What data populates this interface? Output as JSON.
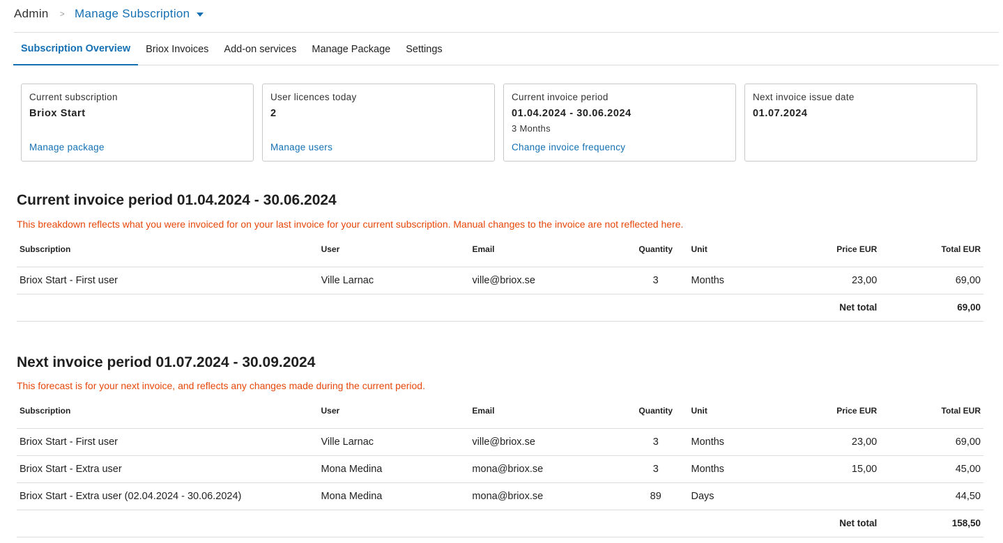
{
  "breadcrumb": {
    "root": "Admin",
    "separator": ">",
    "current": "Manage Subscription",
    "current_icon": "caret-down-icon"
  },
  "tabs": [
    {
      "label": "Subscription Overview",
      "active": true
    },
    {
      "label": "Briox Invoices",
      "active": false
    },
    {
      "label": "Add-on services",
      "active": false
    },
    {
      "label": "Manage Package",
      "active": false
    },
    {
      "label": "Settings",
      "active": false
    }
  ],
  "cards": [
    {
      "label": "Current subscription",
      "value": "Briox Start",
      "sub": "",
      "link": "Manage package"
    },
    {
      "label": "User licences today",
      "value": "2",
      "sub": "",
      "link": "Manage users"
    },
    {
      "label": "Current invoice period",
      "value": "01.04.2024 - 30.06.2024",
      "sub": "3 Months",
      "link": "Change invoice frequency"
    },
    {
      "label": "Next invoice issue date",
      "value": "01.07.2024",
      "sub": "",
      "link": ""
    }
  ],
  "columns": [
    "Subscription",
    "User",
    "Email",
    "Quantity",
    "Unit",
    "Price EUR",
    "Total EUR"
  ],
  "current_period": {
    "title": "Current invoice period 01.04.2024 - 30.06.2024",
    "note": "This breakdown reflects what you were invoiced for on your last invoice for your current subscription. Manual changes to the invoice are not reflected here.",
    "rows": [
      [
        "Briox Start - First user",
        "Ville Larnac",
        "ville@briox.se",
        "3",
        "Months",
        "23,00",
        "69,00"
      ]
    ],
    "net_total_label": "Net total",
    "net_total": "69,00"
  },
  "next_period": {
    "title": "Next invoice period 01.07.2024 - 30.09.2024",
    "note": "This forecast is for your next invoice, and reflects any changes made during the current period.",
    "rows": [
      [
        "Briox Start - First user",
        "Ville Larnac",
        "ville@briox.se",
        "3",
        "Months",
        "23,00",
        "69,00"
      ],
      [
        "Briox Start - Extra user",
        "Mona Medina",
        "mona@briox.se",
        "3",
        "Months",
        "15,00",
        "45,00"
      ],
      [
        "Briox Start - Extra user (02.04.2024 - 30.06.2024)",
        "Mona Medina",
        "mona@briox.se",
        "89",
        "Days",
        "",
        "44,50"
      ]
    ],
    "net_total_label": "Net total",
    "net_total": "158,50"
  },
  "colors": {
    "accent": "#1470b3",
    "warning": "#e8470a",
    "border": "#dcdcdc"
  }
}
